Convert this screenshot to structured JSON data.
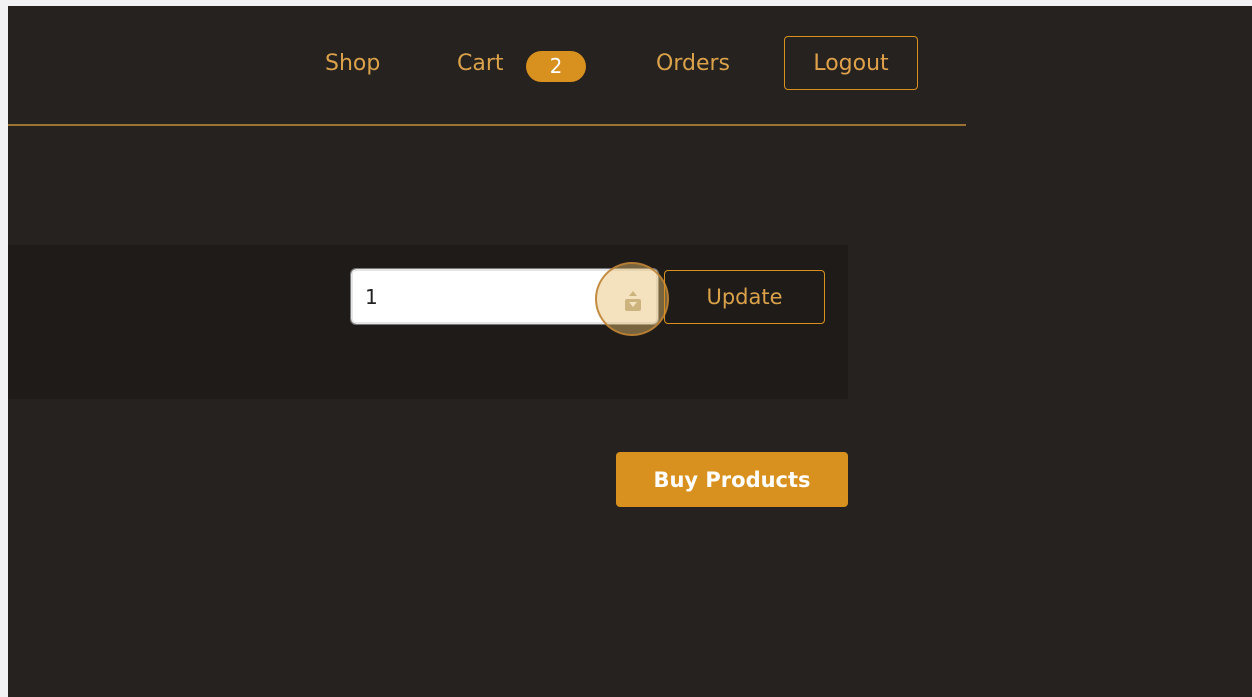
{
  "nav": {
    "shop_label": "Shop",
    "cart_label": "Cart",
    "cart_count": "2",
    "orders_label": "Orders",
    "logout_label": "Logout"
  },
  "cart_item": {
    "quantity_value": "1",
    "update_label": "Update"
  },
  "actions": {
    "buy_label": "Buy Products"
  },
  "colors": {
    "background": "#252220",
    "panel": "#1e1b19",
    "accent": "#d8901e",
    "nav_text": "#dba24a"
  }
}
